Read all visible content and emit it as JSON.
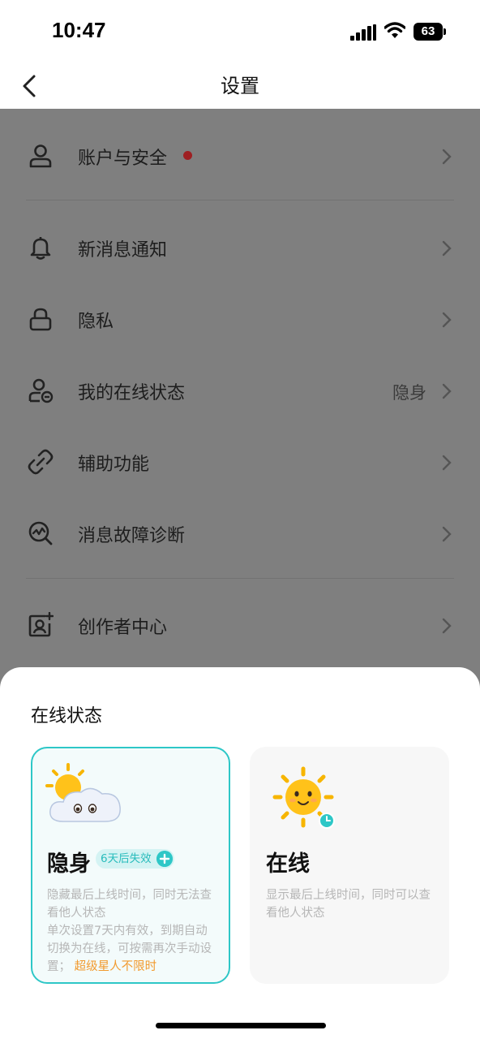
{
  "status_bar": {
    "time": "10:47",
    "battery": "63"
  },
  "nav": {
    "title": "设置"
  },
  "settings_items": [
    {
      "label": "账户与安全",
      "icon": "user-icon",
      "has_dot": true
    },
    {
      "label": "新消息通知",
      "icon": "bell-icon"
    },
    {
      "label": "隐私",
      "icon": "lock-icon"
    },
    {
      "label": "我的在线状态",
      "icon": "user-status-icon",
      "value": "隐身"
    },
    {
      "label": "辅助功能",
      "icon": "link-icon"
    },
    {
      "label": "消息故障诊断",
      "icon": "diagnose-icon"
    },
    {
      "label": "创作者中心",
      "icon": "creator-icon"
    }
  ],
  "sheet": {
    "title": "在线状态",
    "invisible": {
      "title": "隐身",
      "badge": "6天后失效",
      "desc_line1": "隐藏最后上线时间，同时无法查看他人状态",
      "desc_line2": "单次设置7天内有效，到期自动切换为在线，可按需再次手动设置；",
      "highlight": "超级星人不限时",
      "emoji": "cloud-sun-emoji",
      "selected": true
    },
    "online": {
      "title": "在线",
      "desc": "显示最后上线时间，同时可以查看他人状态",
      "emoji": "sun-emoji"
    }
  },
  "colors": {
    "accent": "#2ec7c7",
    "highlight": "#f29a2e",
    "dot": "#9e1f22",
    "overlay": "#7f7f7f"
  }
}
